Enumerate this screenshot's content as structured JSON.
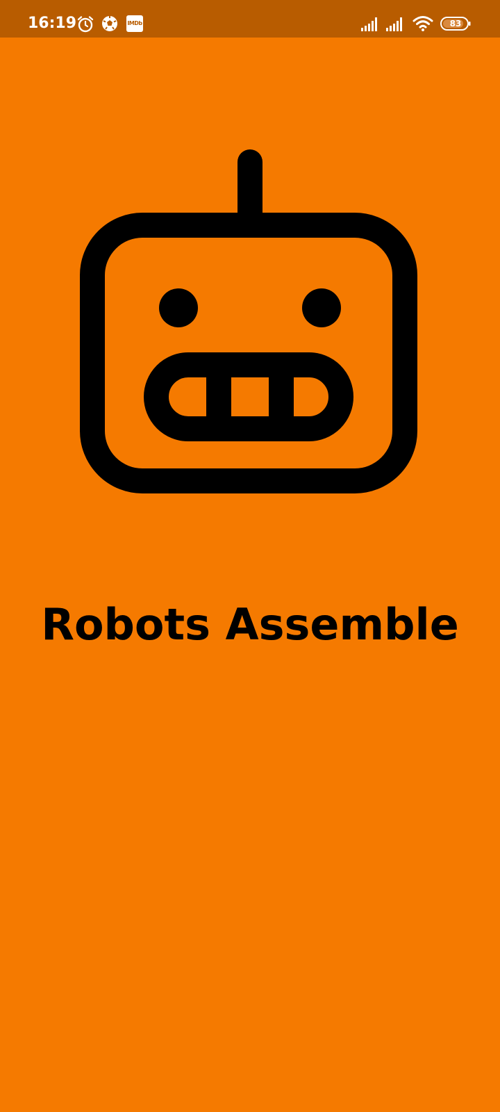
{
  "status_bar": {
    "time": "16:19",
    "battery_level": "83",
    "icons": [
      "alarm-icon",
      "soccer-ball-icon",
      "imdb-icon",
      "signal-icon",
      "signal-icon",
      "wifi-icon",
      "battery-icon"
    ],
    "imdb_label": "IMDb"
  },
  "splash": {
    "title": "Robots Assemble",
    "logo_icon": "robot-icon"
  },
  "colors": {
    "background": "#F57A00",
    "status_bar": "#B85C00",
    "foreground": "#000000"
  }
}
